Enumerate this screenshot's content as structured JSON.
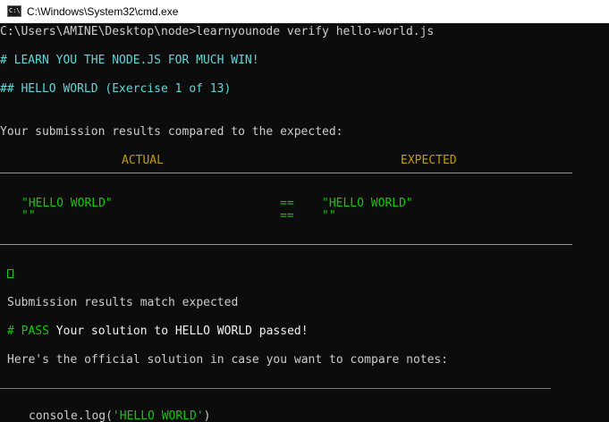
{
  "window": {
    "title": "C:\\Windows\\System32\\cmd.exe",
    "icon": "cmd-icon"
  },
  "terminal": {
    "prompt": "C:\\Users\\AMINE\\Desktop\\node>",
    "command": "learnyounode verify hello-world.js",
    "banner": "# LEARN YOU THE NODE.JS FOR MUCH WIN!",
    "exercise": "## HELLO WORLD (Exercise 1 of 13)",
    "compare_intro": "Your submission results compared to the expected:",
    "actual_header": "ACTUAL",
    "expected_header": "EXPECTED",
    "rows": [
      {
        "actual": "\"HELLO WORLD\"",
        "op": "==",
        "expected": "\"HELLO WORLD\""
      },
      {
        "actual": "\"\"",
        "op": "==",
        "expected": "\"\""
      }
    ],
    "match_message": "Submission results match expected",
    "pass_tag": "# PASS",
    "pass_message": "Your solution to HELLO WORLD passed!",
    "solution_intro": "Here's the official solution in case you want to compare notes:",
    "solution_code_prefix": "console.log(",
    "solution_code_string": "'HELLO WORLD'",
    "solution_code_suffix": ")"
  },
  "colors": {
    "background": "#0c0c0c",
    "text": "#cccccc",
    "cyan": "#61d6d6",
    "yellow": "#c19c00",
    "green": "#16c60c"
  }
}
